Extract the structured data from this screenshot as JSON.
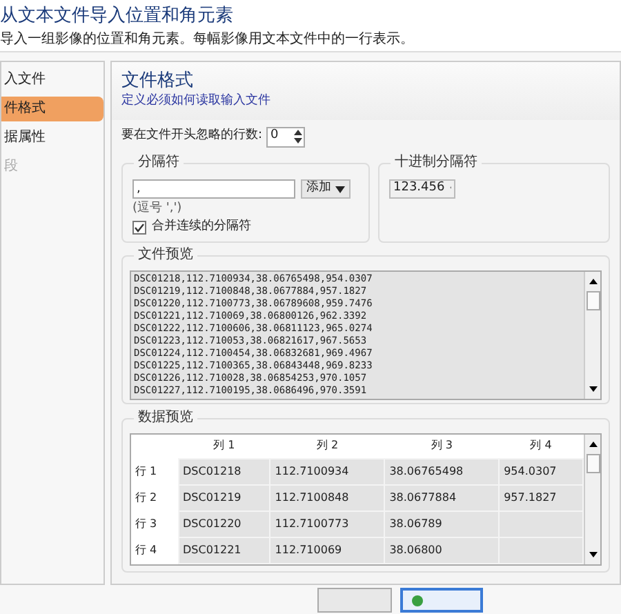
{
  "header": {
    "title": "从文本文件导入位置和角元素",
    "subtitle": "导入一组影像的位置和角元素。每幅影像用文本文件中的一行表示。"
  },
  "sidebar": {
    "items": [
      {
        "label": "入文件",
        "selected": false,
        "disabled": false
      },
      {
        "label": "件格式",
        "selected": true,
        "disabled": false
      },
      {
        "label": "据属性",
        "selected": false,
        "disabled": false
      },
      {
        "label": "段",
        "selected": false,
        "disabled": true
      }
    ]
  },
  "panel": {
    "title": "文件格式",
    "subtitle": "定义必须如何读取输入文件"
  },
  "skip_rows": {
    "label": "要在文件开头忽略的行数:",
    "value": "0"
  },
  "delimiter": {
    "group": "分隔符",
    "value": ",",
    "add_button": "添加",
    "hint": "(逗号 ',')",
    "merge": {
      "label": "合并连续的分隔符",
      "checked": true
    }
  },
  "decimal": {
    "group": "十进制分隔符",
    "value": "123.456"
  },
  "file_preview": {
    "group": "文件预览",
    "lines": [
      "DSC01218,112.7100934,38.06765498,954.0307",
      "DSC01219,112.7100848,38.0677884,957.1827",
      "DSC01220,112.7100773,38.06789608,959.7476",
      "DSC01221,112.710069,38.06800126,962.3392",
      "DSC01222,112.7100606,38.06811123,965.0274",
      "DSC01223,112.710053,38.06821617,967.5653",
      "DSC01224,112.7100454,38.06832681,969.4967",
      "DSC01225,112.7100365,38.06843448,969.8233",
      "DSC01226,112.710028,38.06854253,970.1057",
      "DSC01227,112.7100195,38.0686496,970.3591"
    ]
  },
  "data_preview": {
    "group": "数据预览",
    "columns": [
      "列 1",
      "列 2",
      "列 3",
      "列 4"
    ],
    "rows": [
      {
        "label": "行 1",
        "cells": [
          "DSC01218",
          "112.7100934",
          "38.06765498",
          "954.0307"
        ]
      },
      {
        "label": "行 2",
        "cells": [
          "DSC01219",
          "112.7100848",
          "38.0677884",
          "957.1827"
        ]
      },
      {
        "label": "行 3",
        "cells": [
          "DSC01220",
          "112.7100773",
          "38.06789",
          ""
        ]
      },
      {
        "label": "行 4",
        "cells": [
          "DSC01221",
          "112.710069",
          "38.06800",
          ""
        ]
      }
    ]
  }
}
